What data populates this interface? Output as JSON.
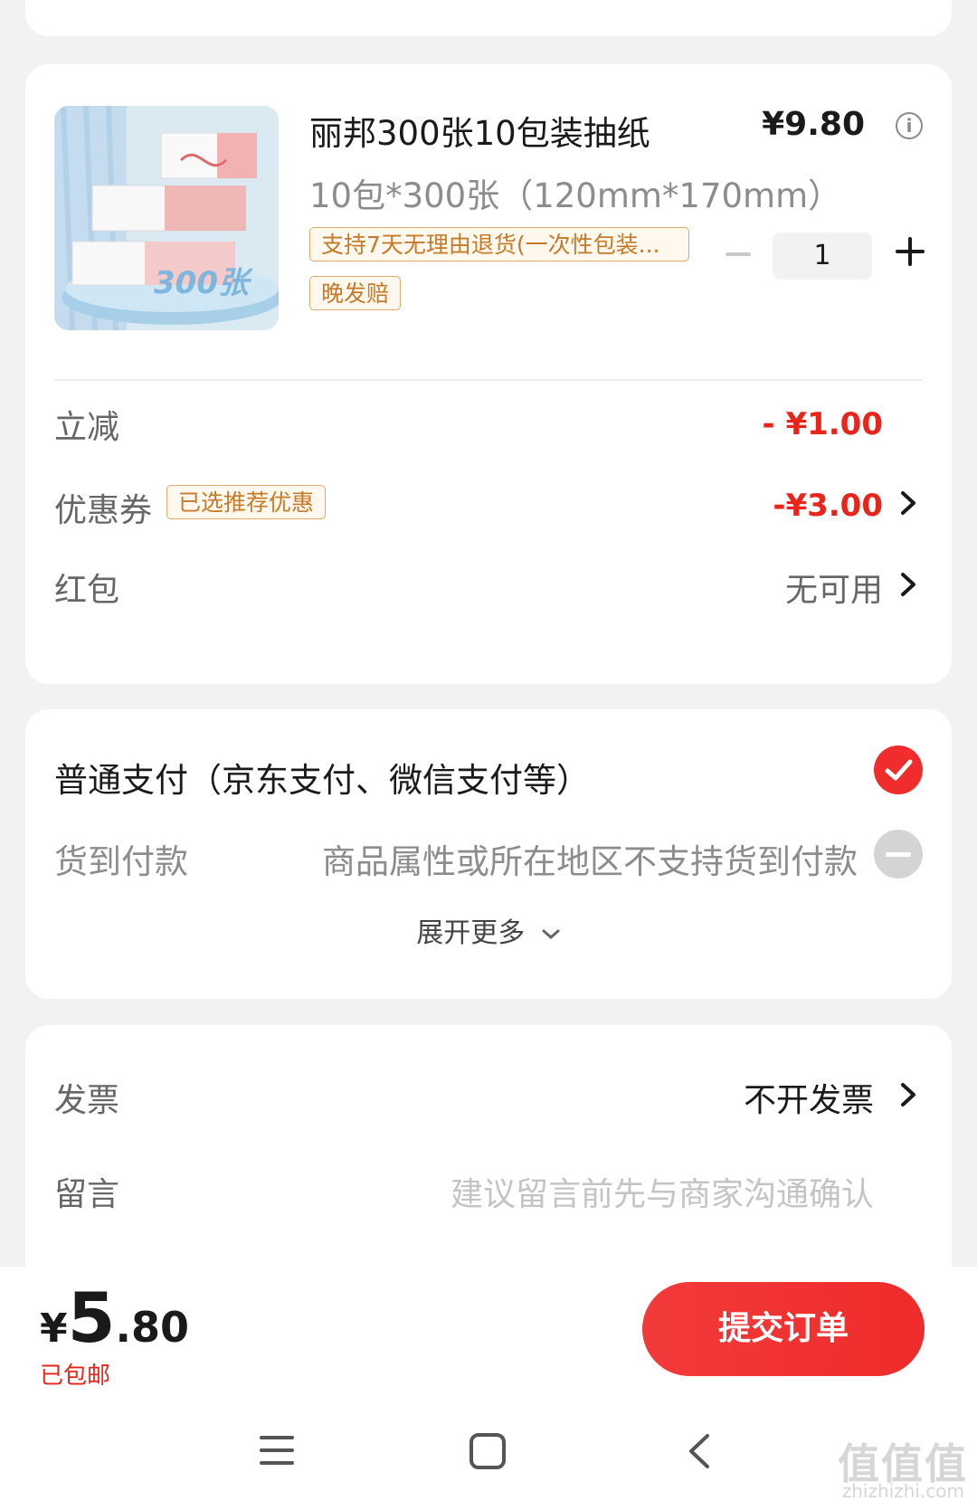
{
  "product": {
    "title": "丽邦300张10包装抽纸",
    "price": "¥9.80",
    "spec": "10包*300张（120mm*170mm）",
    "tags": [
      "支持7天无理由退货(一次性包装...",
      "晚发赔"
    ],
    "quantity": "1",
    "image_badge": "300张"
  },
  "discounts": {
    "instant": {
      "label": "立减",
      "value": "- ¥1.00"
    },
    "coupon": {
      "label": "优惠券",
      "badge": "已选推荐优惠",
      "value": "-¥3.00"
    },
    "red_packet": {
      "label": "红包",
      "value": "无可用"
    }
  },
  "payment": {
    "normal": "普通支付（京东支付、微信支付等）",
    "cod_label": "货到付款",
    "cod_note": "商品属性或所在地区不支持货到付款",
    "expand": "展开更多"
  },
  "invoice": {
    "label": "发票",
    "value": "不开发票",
    "note_label": "留言",
    "note_placeholder": "建议留言前先与商家沟通确认"
  },
  "bottom": {
    "currency": "¥",
    "total_int": "5",
    "total_dec": ".80",
    "shipping": "已包邮",
    "submit": "提交订单"
  },
  "watermark": {
    "main": "值值值",
    "sub": "zhizhizhi.com"
  },
  "colors": {
    "accent": "#e8251a",
    "tag_border": "#e0a86a",
    "tag_text": "#c67a27",
    "check": "#f02c2c"
  }
}
